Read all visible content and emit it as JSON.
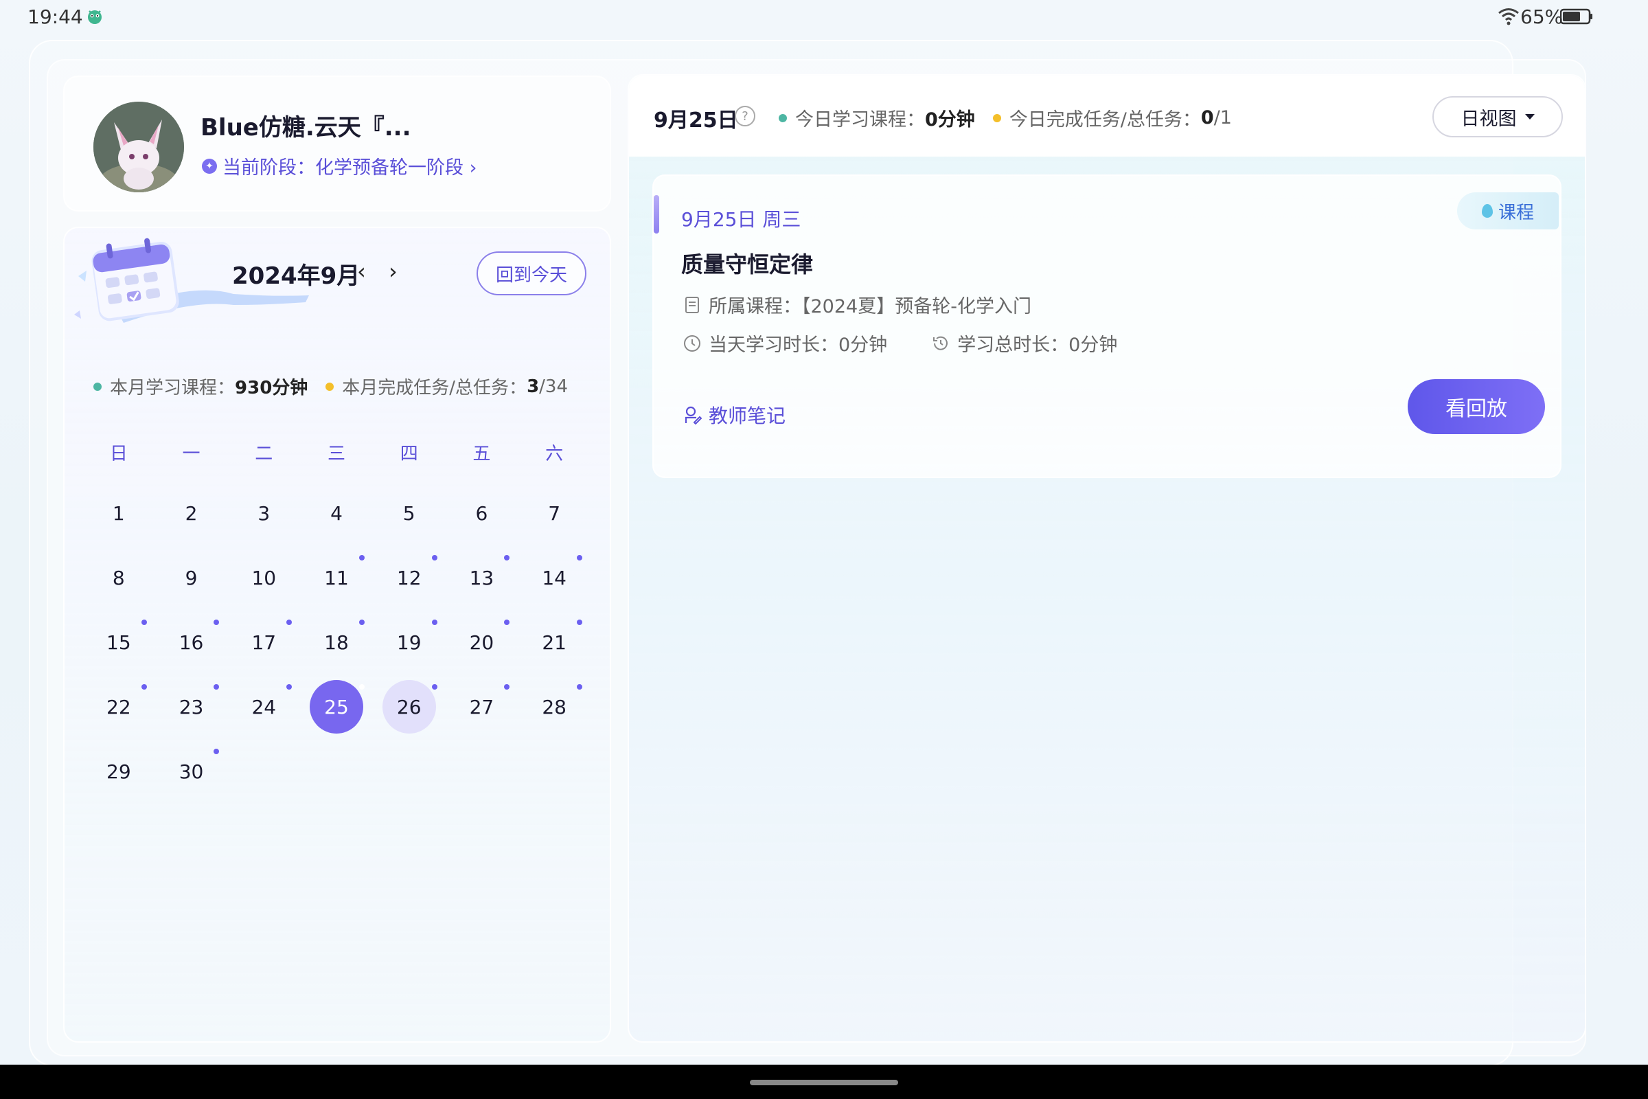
{
  "status_bar": {
    "time": "19:44",
    "battery": "65%"
  },
  "profile": {
    "username": "Blue仿糖.云天『...",
    "stage_label": "当前阶段：化学预备轮一阶段 ›"
  },
  "calendar": {
    "month_title": "2024年9月",
    "prev_icon": "‹",
    "next_icon": "›",
    "today_button": "回到今天",
    "stats": {
      "course_label": "本月学习课程：",
      "course_value": "930分钟",
      "task_label": "本月完成任务/总任务：",
      "task_done": "3",
      "task_total": "/34"
    },
    "weekdays": [
      "日",
      "一",
      "二",
      "三",
      "四",
      "五",
      "六"
    ],
    "days": [
      {
        "d": "1",
        "mark": false
      },
      {
        "d": "2",
        "mark": false
      },
      {
        "d": "3",
        "mark": false
      },
      {
        "d": "4",
        "mark": false
      },
      {
        "d": "5",
        "mark": false
      },
      {
        "d": "6",
        "mark": false
      },
      {
        "d": "7",
        "mark": false
      },
      {
        "d": "8",
        "mark": false
      },
      {
        "d": "9",
        "mark": false
      },
      {
        "d": "10",
        "mark": false
      },
      {
        "d": "11",
        "mark": true
      },
      {
        "d": "12",
        "mark": true
      },
      {
        "d": "13",
        "mark": true
      },
      {
        "d": "14",
        "mark": true
      },
      {
        "d": "15",
        "mark": true
      },
      {
        "d": "16",
        "mark": true
      },
      {
        "d": "17",
        "mark": true
      },
      {
        "d": "18",
        "mark": true
      },
      {
        "d": "19",
        "mark": true
      },
      {
        "d": "20",
        "mark": true
      },
      {
        "d": "21",
        "mark": true
      },
      {
        "d": "22",
        "mark": true
      },
      {
        "d": "23",
        "mark": true
      },
      {
        "d": "24",
        "mark": true
      },
      {
        "d": "25",
        "mark": true,
        "state": "selected"
      },
      {
        "d": "26",
        "mark": true,
        "state": "tomorrow"
      },
      {
        "d": "27",
        "mark": true
      },
      {
        "d": "28",
        "mark": true
      },
      {
        "d": "29",
        "mark": false
      },
      {
        "d": "30",
        "mark": true
      }
    ]
  },
  "day_view": {
    "date": "9月25日",
    "help_icon": "?",
    "course_label": "今日学习课程：",
    "course_value": "0分钟",
    "task_label": "今日完成任务/总任务：",
    "task_done": "0",
    "task_total": "/1",
    "view_button": "日视图"
  },
  "lesson": {
    "date": "9月25日 周三",
    "tag": "课程",
    "title": "质量守恒定律",
    "course_row": "所属课程：【2024夏】预备轮-化学入门",
    "day_duration": "当天学习时长：0分钟",
    "total_duration": "学习总时长：0分钟",
    "notes_label": "教师笔记",
    "replay_button": "看回放"
  },
  "colors": {
    "accent": "#5a4fd8",
    "selected_day": "#7867ef",
    "green_dot": "#4db6a3",
    "yellow_dot": "#f4bf2a"
  }
}
